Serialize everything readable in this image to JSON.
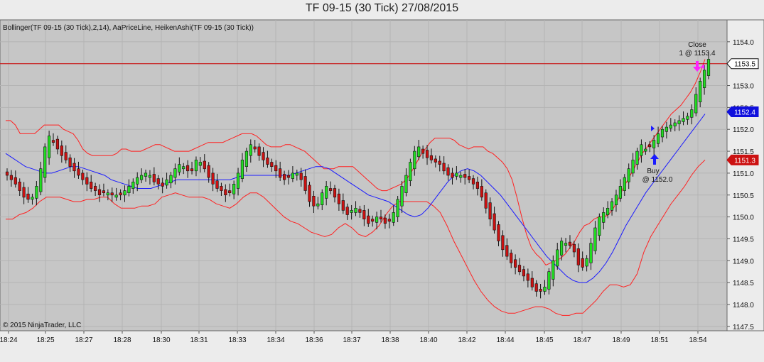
{
  "chart_data": {
    "type": "candlestick",
    "title": "TF 09-15 (30 Tick)  27/08/2015",
    "indicators_label": "Bollinger(TF 09-15 (30 Tick),2,14), AaPriceLine, HeikenAshi(TF 09-15 (30 Tick))",
    "copyright": "© 2015 NinjaTrader, LLC",
    "ylim": [
      1147.4,
      1154.5
    ],
    "y_ticks": [
      "1154.0",
      "1153.5",
      "1153.0",
      "1152.5",
      "1152.0",
      "1151.5",
      "1151.0",
      "1150.5",
      "1150.0",
      "1149.5",
      "1149.0",
      "1148.5",
      "1148.0",
      "1147.5"
    ],
    "x_ticks": [
      "18:24",
      "18:25",
      "18:27",
      "18:28",
      "18:30",
      "18:31",
      "18:33",
      "18:34",
      "18:36",
      "18:37",
      "18:38",
      "18:40",
      "18:42",
      "18:44",
      "18:45",
      "18:47",
      "18:49",
      "18:51",
      "18:54"
    ],
    "grid": true,
    "price_line": {
      "value": 1153.5,
      "label": "1153.5"
    },
    "markers": [
      {
        "label": "1152.4",
        "value": 1152.4,
        "color": "#1010dd"
      },
      {
        "label": "1151.3",
        "value": 1151.3,
        "color": "#cc1111"
      }
    ],
    "close_values": [
      1150.95,
      1150.85,
      1150.75,
      1150.6,
      1150.45,
      1150.4,
      1150.45,
      1150.7,
      1151.1,
      1151.6,
      1151.85,
      1151.7,
      1151.55,
      1151.4,
      1151.3,
      1151.15,
      1151.05,
      1150.95,
      1150.85,
      1150.75,
      1150.65,
      1150.6,
      1150.5,
      1150.55,
      1150.55,
      1150.5,
      1150.5,
      1150.5,
      1150.6,
      1150.7,
      1150.8,
      1150.9,
      1150.95,
      1151.0,
      1150.95,
      1150.8,
      1150.75,
      1150.7,
      1150.85,
      1150.95,
      1151.1,
      1151.2,
      1151.15,
      1151.05,
      1151.05,
      1151.3,
      1151.25,
      1151.1,
      1150.9,
      1150.75,
      1150.65,
      1150.6,
      1150.5,
      1150.55,
      1150.75,
      1151.0,
      1151.3,
      1151.5,
      1151.65,
      1151.55,
      1151.4,
      1151.3,
      1151.2,
      1151.15,
      1151.05,
      1150.9,
      1150.85,
      1150.9,
      1151.0,
      1151.0,
      1150.85,
      1150.6,
      1150.35,
      1150.25,
      1150.3,
      1150.55,
      1150.7,
      1150.6,
      1150.45,
      1150.3,
      1150.15,
      1150.05,
      1150.15,
      1150.2,
      1150.1,
      1149.95,
      1149.85,
      1149.9,
      1150.0,
      1149.95,
      1149.85,
      1149.9,
      1150.1,
      1150.4,
      1150.7,
      1150.95,
      1151.25,
      1151.5,
      1151.6,
      1151.45,
      1151.35,
      1151.3,
      1151.25,
      1151.2,
      1151.05,
      1150.95,
      1150.9,
      1151.0,
      1150.95,
      1150.9,
      1150.85,
      1150.75,
      1150.65,
      1150.45,
      1150.2,
      1149.95,
      1149.7,
      1149.45,
      1149.25,
      1149.1,
      1148.95,
      1148.85,
      1148.75,
      1148.65,
      1148.55,
      1148.4,
      1148.3,
      1148.3,
      1148.4,
      1148.75,
      1149.0,
      1149.25,
      1149.45,
      1149.4,
      1149.35,
      1149.2,
      1148.9,
      1148.85,
      1149.05,
      1149.4,
      1149.75,
      1150.0,
      1150.1,
      1150.2,
      1150.35,
      1150.5,
      1150.7,
      1150.9,
      1151.1,
      1151.3,
      1151.5,
      1151.65,
      1151.55,
      1151.6,
      1151.75,
      1151.9,
      1152.0,
      1152.05,
      1152.1,
      1152.15,
      1152.2,
      1152.25,
      1152.3,
      1152.45,
      1152.8,
      1153.1,
      1153.35,
      1153.6
    ],
    "bollinger_upper": [
      1152.2,
      1152.2,
      1152.1,
      1151.9,
      1151.9,
      1151.9,
      1151.9,
      1152.0,
      1152.1,
      1152.1,
      1152.1,
      1152.1,
      1152.0,
      1151.95,
      1151.9,
      1151.75,
      1151.55,
      1151.45,
      1151.4,
      1151.4,
      1151.4,
      1151.4,
      1151.4,
      1151.45,
      1151.55,
      1151.55,
      1151.5,
      1151.5,
      1151.5,
      1151.55,
      1151.6,
      1151.65,
      1151.65,
      1151.6,
      1151.55,
      1151.5,
      1151.5,
      1151.5,
      1151.5,
      1151.55,
      1151.6,
      1151.65,
      1151.7,
      1151.7,
      1151.7,
      1151.7,
      1151.75,
      1151.8,
      1151.85,
      1151.9,
      1151.9,
      1151.9,
      1151.85,
      1151.75,
      1151.65,
      1151.6,
      1151.6,
      1151.6,
      1151.65,
      1151.65,
      1151.6,
      1151.55,
      1151.5,
      1151.4,
      1151.3,
      1151.2,
      1151.1,
      1151.1,
      1151.1,
      1151.15,
      1151.15,
      1151.15,
      1151.15,
      1151.05,
      1150.95,
      1150.85,
      1150.75,
      1150.65,
      1150.6,
      1150.6,
      1150.65,
      1150.7,
      1150.75,
      1150.85,
      1151.0,
      1151.2,
      1151.4,
      1151.55,
      1151.7,
      1151.8,
      1151.8,
      1151.8,
      1151.8,
      1151.75,
      1151.65,
      1151.6,
      1151.55,
      1151.6,
      1151.6,
      1151.6,
      1151.5,
      1151.45,
      1151.35,
      1151.25,
      1151.1,
      1150.85,
      1150.45,
      1150.0,
      1149.6,
      1149.3,
      1149.15,
      1149.05,
      1148.9,
      1148.95,
      1149.0,
      1149.05,
      1149.15,
      1149.3,
      1149.45,
      1149.65,
      1149.8,
      1149.85,
      1149.95,
      1150.0,
      1150.0,
      1150.05,
      1150.2,
      1150.4,
      1150.65,
      1150.85,
      1151.05,
      1151.25,
      1151.45,
      1151.6,
      1151.75,
      1151.9,
      1152.05,
      1152.2,
      1152.35,
      1152.45,
      1152.55,
      1152.7,
      1152.85,
      1153.05,
      1153.3,
      1153.6
    ],
    "bollinger_middle": [
      1151.45,
      1151.35,
      1151.25,
      1151.15,
      1151.1,
      1151.05,
      1151.0,
      1151.0,
      1151.05,
      1151.1,
      1151.15,
      1151.15,
      1151.1,
      1151.05,
      1151.0,
      1150.95,
      1150.85,
      1150.8,
      1150.75,
      1150.7,
      1150.65,
      1150.65,
      1150.65,
      1150.7,
      1150.75,
      1150.8,
      1150.85,
      1150.85,
      1150.85,
      1150.85,
      1150.85,
      1150.85,
      1150.85,
      1150.85,
      1150.85,
      1150.9,
      1150.95,
      1150.95,
      1150.95,
      1150.95,
      1150.95,
      1150.95,
      1150.95,
      1150.95,
      1151.0,
      1151.05,
      1151.1,
      1151.15,
      1151.15,
      1151.1,
      1151.0,
      1150.9,
      1150.8,
      1150.7,
      1150.6,
      1150.5,
      1150.45,
      1150.4,
      1150.35,
      1150.25,
      1150.15,
      1150.05,
      1150.0,
      1150.05,
      1150.2,
      1150.4,
      1150.6,
      1150.8,
      1150.95,
      1151.05,
      1151.1,
      1151.05,
      1150.95,
      1150.8,
      1150.65,
      1150.5,
      1150.3,
      1150.1,
      1149.9,
      1149.7,
      1149.5,
      1149.3,
      1149.1,
      1148.95,
      1148.8,
      1148.65,
      1148.55,
      1148.5,
      1148.5,
      1148.6,
      1148.75,
      1148.95,
      1149.2,
      1149.5,
      1149.8,
      1150.05,
      1150.3,
      1150.55,
      1150.75,
      1150.95,
      1151.15,
      1151.35,
      1151.55,
      1151.75,
      1151.95,
      1152.15,
      1152.35
    ],
    "bollinger_lower": [
      1149.95,
      1149.95,
      1150.05,
      1150.1,
      1150.2,
      1150.35,
      1150.45,
      1150.45,
      1150.45,
      1150.4,
      1150.35,
      1150.35,
      1150.4,
      1150.4,
      1150.45,
      1150.45,
      1150.3,
      1150.2,
      1150.2,
      1150.2,
      1150.25,
      1150.25,
      1150.3,
      1150.45,
      1150.5,
      1150.55,
      1150.5,
      1150.45,
      1150.45,
      1150.45,
      1150.4,
      1150.3,
      1150.25,
      1150.2,
      1150.3,
      1150.45,
      1150.55,
      1150.55,
      1150.45,
      1150.3,
      1150.15,
      1150.0,
      1149.9,
      1149.85,
      1149.75,
      1149.65,
      1149.6,
      1149.55,
      1149.6,
      1149.75,
      1149.85,
      1149.75,
      1149.6,
      1149.55,
      1149.65,
      1149.8,
      1150.05,
      1150.25,
      1150.35,
      1150.35,
      1150.35,
      1150.35,
      1150.35,
      1150.25,
      1150.1,
      1149.8,
      1149.45,
      1149.15,
      1148.85,
      1148.55,
      1148.3,
      1148.1,
      1147.95,
      1147.85,
      1147.8,
      1147.8,
      1147.85,
      1147.9,
      1147.95,
      1147.95,
      1147.9,
      1147.8,
      1147.75,
      1147.75,
      1147.8,
      1147.8,
      1147.95,
      1148.1,
      1148.3,
      1148.45,
      1148.45,
      1148.4,
      1148.45,
      1148.7,
      1149.2,
      1149.55,
      1149.8,
      1150.05,
      1150.3,
      1150.5,
      1150.7,
      1150.95,
      1151.15,
      1151.3
    ],
    "annotations": [
      {
        "label": "Buy",
        "price_label": "@ 1152.0"
      },
      {
        "label": "Close",
        "price_label": "1 @ 1153.4"
      }
    ]
  }
}
